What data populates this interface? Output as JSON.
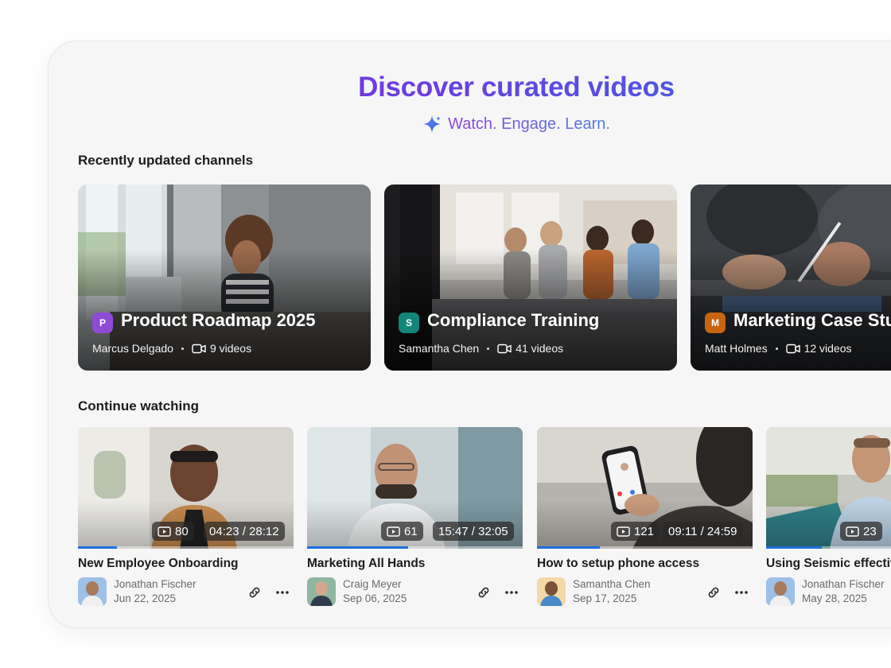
{
  "hero": {
    "title": "Discover curated videos",
    "subtitle": "Watch. Engage. Learn."
  },
  "sections": {
    "channels_title": "Recently updated channels",
    "continue_title": "Continue watching"
  },
  "channels": [
    {
      "badge": "P",
      "badge_color": "#8e4bd6",
      "name": "Product Roadmap 2025",
      "owner": "Marcus Delgado",
      "videos": "9 videos"
    },
    {
      "badge": "S",
      "badge_color": "#13857a",
      "name": "Compliance Training",
      "owner": "Samantha Chen",
      "videos": "41 videos"
    },
    {
      "badge": "M",
      "badge_color": "#c7650f",
      "name": "Marketing Case Stu",
      "owner": "Matt Holmes",
      "videos": "12 videos"
    }
  ],
  "videos": [
    {
      "views": "80",
      "time": "04:23 / 28:12",
      "progress": 0.18,
      "title": "New Employee Onboarding",
      "author": "Jonathan Fischer",
      "date": "Jun 22, 2025"
    },
    {
      "views": "61",
      "time": "15:47 / 32:05",
      "progress": 0.47,
      "title": "Marketing All Hands",
      "author": "Craig Meyer",
      "date": "Sep 06, 2025"
    },
    {
      "views": "121",
      "time": "09:11 / 24:59",
      "progress": 0.29,
      "title": "How to setup phone access",
      "author": "Samantha Chen",
      "date": "Sep 17, 2025"
    },
    {
      "views": "23",
      "time": "",
      "progress": 0.26,
      "title": "Using Seismic effectiv",
      "author": "Jonathan Fischer",
      "date": "May 28, 2025"
    }
  ],
  "colors": {
    "accent": "#1e6ee0",
    "title_gradient_start": "#8a2be2",
    "title_gradient_end": "#2f6fe3"
  },
  "icons": {
    "subtitle": "sparkle-icon",
    "video_count": "video-camera-icon",
    "views": "play-icon",
    "link": "link-icon",
    "more": "more-horizontal-icon"
  }
}
